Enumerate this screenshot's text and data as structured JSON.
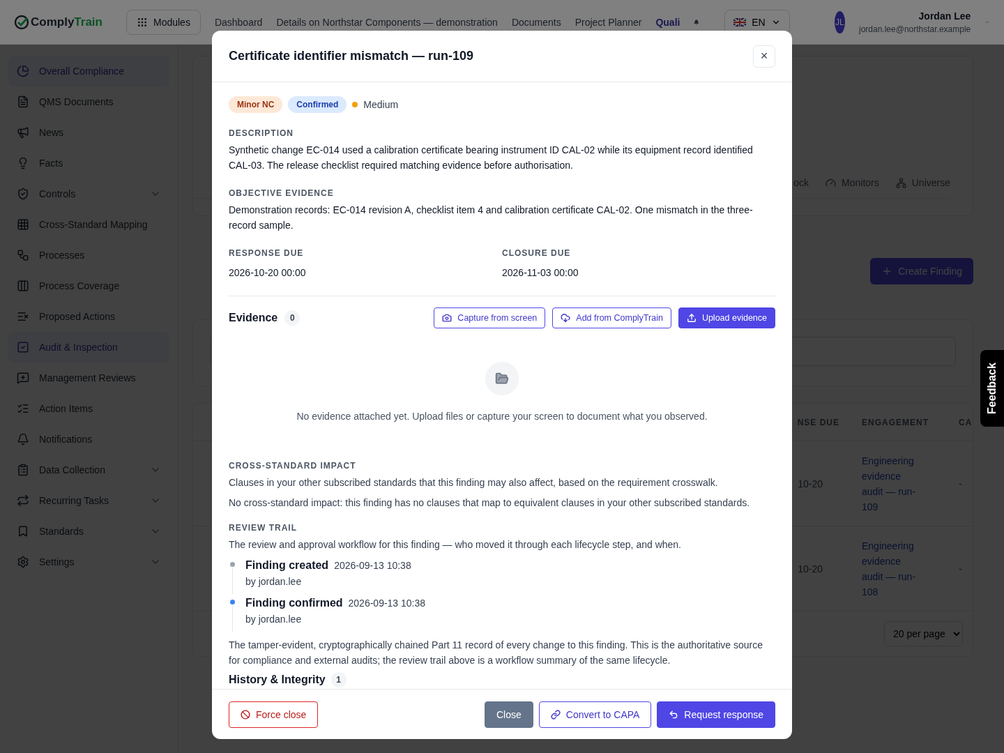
{
  "topbar": {
    "logo": {
      "first": "Comply",
      "second": "Train"
    },
    "modules_button": "Modules",
    "nav": [
      {
        "label": "Dashboard",
        "selected": false
      },
      {
        "label": "Details on Northstar Components — demonstration",
        "selected": false
      },
      {
        "label": "Documents",
        "selected": false
      },
      {
        "label": "Project Planner",
        "selected": false
      },
      {
        "label": "Quali",
        "selected": true
      }
    ],
    "language": "EN",
    "user": {
      "initials": "JL",
      "name": "Jordan Lee",
      "email": "jordan.lee@northstar.example"
    }
  },
  "sidebar": {
    "items": [
      {
        "label": "Overall Compliance",
        "selected": true,
        "expandable": false
      },
      {
        "label": "QMS Documents",
        "selected": false,
        "expandable": false
      },
      {
        "label": "News",
        "selected": false,
        "expandable": false
      },
      {
        "label": "Facts",
        "selected": false,
        "expandable": false
      },
      {
        "label": "Controls",
        "selected": false,
        "expandable": true
      },
      {
        "label": "Cross-Standard Mapping",
        "selected": false,
        "expandable": false
      },
      {
        "label": "Processes",
        "selected": false,
        "expandable": false
      },
      {
        "label": "Process Coverage",
        "selected": false,
        "expandable": false
      },
      {
        "label": "Proposed Actions",
        "selected": false,
        "expandable": false
      },
      {
        "label": "Audit & Inspection",
        "selected": true,
        "expandable": false
      },
      {
        "label": "Management Reviews",
        "selected": false,
        "expandable": false
      },
      {
        "label": "Action Items",
        "selected": false,
        "expandable": false
      },
      {
        "label": "Notifications",
        "selected": false,
        "expandable": false
      },
      {
        "label": "Data Collection",
        "selected": false,
        "expandable": true
      },
      {
        "label": "Recurring Tasks",
        "selected": false,
        "expandable": true
      },
      {
        "label": "Standards",
        "selected": false,
        "expandable": true
      },
      {
        "label": "Settings",
        "selected": false,
        "expandable": true
      }
    ]
  },
  "main": {
    "tabs": [
      {
        "label": "ock"
      },
      {
        "label": "Monitors"
      },
      {
        "label": "Universe"
      }
    ],
    "create_button": "Create Finding",
    "table": {
      "columns": [
        "NSE DUE",
        "ENGAGEMENT",
        "CA"
      ],
      "rows": [
        {
          "cells": [
            "10-20",
            "Engineering evidence audit — run-109",
            "-"
          ]
        },
        {
          "cells": [
            "10-20",
            "Engineering evidence audit — run-108",
            "-"
          ]
        }
      ]
    },
    "per_page": "20 per page"
  },
  "feedback": "Feedback",
  "modal": {
    "title": "Certificate identifier mismatch — run-109",
    "close_icon": "×",
    "tags": [
      {
        "label": "Minor NC",
        "kind": "type"
      },
      {
        "label": "Confirmed",
        "kind": "status"
      }
    ],
    "severity": {
      "label": "Medium",
      "color": "#f59e0b"
    },
    "description": {
      "label": "DESCRIPTION",
      "text": "Synthetic change EC-014 used a calibration certificate bearing instrument ID CAL-02 while its equipment record identified CAL-03. The release checklist required matching evidence before authorisation."
    },
    "objective_evidence": {
      "label": "OBJECTIVE EVIDENCE",
      "text": "Demonstration records: EC-014 revision A, checklist item 4 and calibration certificate CAL-02. One mismatch in the three-record sample."
    },
    "dates": [
      {
        "label": "RESPONSE DUE",
        "value": "2026-10-20 00:00"
      },
      {
        "label": "CLOSURE DUE",
        "value": "2026-11-03 00:00"
      }
    ],
    "evidence": {
      "title": "Evidence",
      "count": "0",
      "buttons": [
        {
          "label": "Capture from screen",
          "kind": "outline"
        },
        {
          "label": "Add from ComplyTrain",
          "kind": "outline"
        },
        {
          "label": "Upload evidence",
          "kind": "primary"
        }
      ],
      "empty_text": "No evidence attached yet. Upload files or capture your screen to document what you observed."
    },
    "cross_standard": {
      "label": "CROSS-STANDARD IMPACT",
      "intro": "Clauses in your other subscribed standards that this finding may also affect, based on the requirement crosswalk.",
      "note": "No cross-standard impact: this finding has no clauses that map to equivalent clauses in your other subscribed standards."
    },
    "review_trail": {
      "label": "REVIEW TRAIL",
      "intro": "The review and approval workflow for this finding — who moved it through each lifecycle step, and when.",
      "events": [
        {
          "title": "Finding created",
          "time": "2026-09-13 10:38",
          "by": "by jordan.lee",
          "color": "#9ca3af"
        },
        {
          "title": "Finding confirmed",
          "time": "2026-09-13 10:38",
          "by": "by jordan.lee",
          "color": "#3b82f6"
        }
      ]
    },
    "integrity_note": "The tamper-evident, cryptographically chained Part 11 record of every change to this finding. This is the authoritative source for compliance and external audits; the review trail above is a workflow summary of the same lifecycle.",
    "history": {
      "title": "History & Integrity",
      "count": "1"
    },
    "footer_buttons": [
      {
        "label": "Force close",
        "kind": "danger"
      },
      {
        "label": "Close",
        "kind": "secondary"
      },
      {
        "label": "Convert to CAPA",
        "kind": "outline"
      },
      {
        "label": "Request response",
        "kind": "primary"
      }
    ]
  }
}
